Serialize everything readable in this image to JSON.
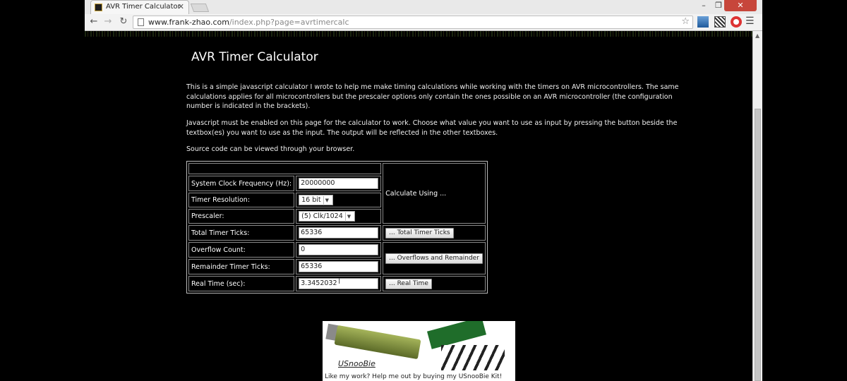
{
  "browser": {
    "tab_title": "AVR Timer Calculator",
    "url_host": "www.frank-zhao.com",
    "url_path": "/index.php?page=avrtimercalc"
  },
  "page": {
    "title": "AVR Timer Calculator",
    "p1": "This is a simple javascript calculator I wrote to help me make timing calculations while working with the timers on AVR microcontrollers. The same calculations applies for all microcontrollers but the prescaler options only contain the ones possible on an AVR microcontroller (the configuration number is indicated in the brackets).",
    "p2": "Javascript must be enabled on this page for the calculator to work. Choose what value you want to use as input by pressing the button beside the textbox(es) you want to use as the input. The output will be reflected in the other textboxes.",
    "p3": "Source code can be viewed through your browser."
  },
  "calculator": {
    "clock_label": "System Clock Frequency (Hz):",
    "clock_value": "20000000",
    "calc_using_label": "Calculate Using ...",
    "resolution_label": "Timer Resolution:",
    "resolution_value": "16 bit",
    "prescaler_label": "Prescaler:",
    "prescaler_value": "(5) Clk/1024",
    "ticks_label": "Total Timer Ticks:",
    "ticks_value": "65336",
    "ticks_button": "... Total Timer Ticks",
    "overflow_label": "Overflow Count:",
    "overflow_value": "0",
    "overflow_button": "... Overflows and Remainder",
    "remainder_label": "Remainder Timer Ticks:",
    "remainder_value": "65336",
    "realtime_label": "Real Time (sec):",
    "realtime_value": "3.3452032",
    "realtime_button": "... Real Time"
  },
  "banner": {
    "logo_text": "USnooBie",
    "tagline": "Like my work? Help me out by buying my USnooBie Kit!"
  }
}
